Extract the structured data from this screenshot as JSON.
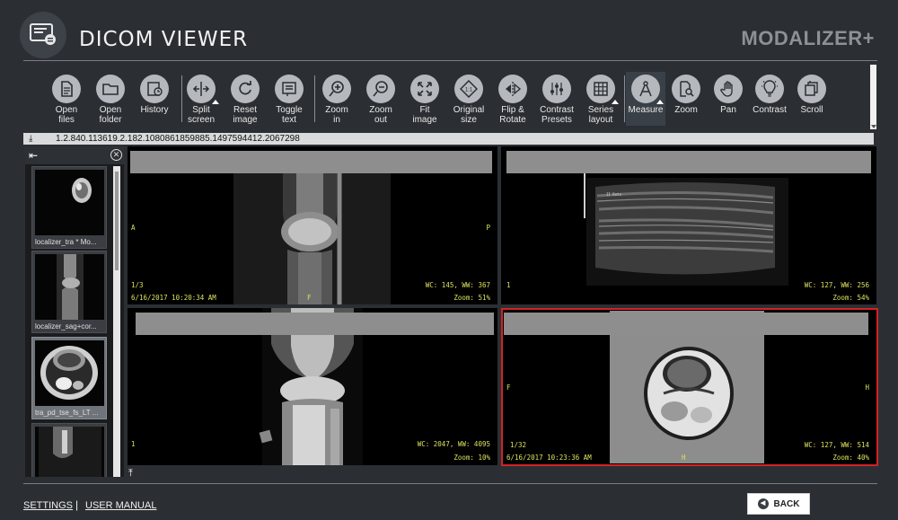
{
  "app": {
    "title": "DICOM  VIEWER",
    "brand": "MODALIZER+"
  },
  "toolbar": [
    {
      "label": "Open\nfiles",
      "icon": "open-files-icon"
    },
    {
      "label": "Open\nfolder",
      "icon": "open-folder-icon"
    },
    {
      "label": "History",
      "icon": "history-icon"
    },
    {
      "label": "Split\nscreen",
      "icon": "split-screen-icon"
    },
    {
      "label": "Reset\nimage",
      "icon": "reset-image-icon"
    },
    {
      "label": "Toggle\ntext",
      "icon": "toggle-text-icon"
    },
    {
      "label": "Zoom\nin",
      "icon": "zoom-in-icon"
    },
    {
      "label": "Zoom\nout",
      "icon": "zoom-out-icon"
    },
    {
      "label": "Fit\nimage",
      "icon": "fit-image-icon"
    },
    {
      "label": "Original\nsize",
      "icon": "original-size-icon"
    },
    {
      "label": "Flip &\nRotate",
      "icon": "flip-rotate-icon"
    },
    {
      "label": "Contrast\nPresets",
      "icon": "contrast-presets-icon"
    },
    {
      "label": "Series\nlayout",
      "icon": "series-layout-icon"
    },
    {
      "label": "Measure",
      "icon": "measure-icon"
    },
    {
      "label": "Zoom",
      "icon": "zoom-tool-icon"
    },
    {
      "label": "Pan",
      "icon": "pan-hand-icon"
    },
    {
      "label": "Contrast",
      "icon": "contrast-bulb-icon"
    },
    {
      "label": "Scroll",
      "icon": "scroll-stack-icon"
    }
  ],
  "path": {
    "uid": "1.2.840.113619.2.182.1080861859885.1497594412.2067298"
  },
  "series": [
    {
      "caption": "localizer_tra * Mo..."
    },
    {
      "caption": "localizer_sag+cor..."
    },
    {
      "caption": "tra_pd_tse_fs_LT ..."
    }
  ],
  "viewports": [
    {
      "left": "A",
      "right": "P",
      "bottom_center": "F",
      "index": "1/3",
      "date": "6/16/2017 10:20:34 AM",
      "wcww": "WC: 145, WW: 367",
      "zoom": "Zoom: 51%"
    },
    {
      "index": "1",
      "wcww": "WC: 127, WW: 256",
      "zoom": "Zoom: 54%"
    },
    {
      "index": "1",
      "wcww": "WC: 2047, WW: 4095",
      "zoom": "Zoom: 10%"
    },
    {
      "left": "F",
      "right": "H",
      "bottom_center": "H",
      "index": "1/32",
      "date": "6/16/2017 10:23:36 AM",
      "wcww": "WC: 127, WW: 514",
      "zoom": "Zoom: 40%"
    }
  ],
  "footer": {
    "settings": "SETTINGS",
    "separator": "|",
    "manual": "USER MANUAL",
    "back": "BACK"
  },
  "colors": {
    "background": "#2b2f33",
    "overlay_text": "#dbe35c",
    "selected_border": "#d32226"
  }
}
